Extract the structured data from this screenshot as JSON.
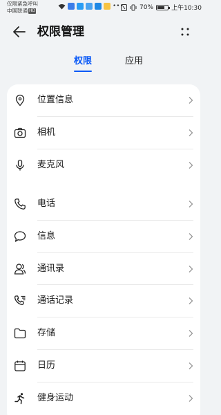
{
  "status_bar": {
    "line1": "仅限紧急呼叫",
    "line2": "中国联通",
    "hd": "HD",
    "battery_text": "70%",
    "battery_level": 0.7,
    "time": "上午10:30"
  },
  "header": {
    "title": "权限管理"
  },
  "tabs": [
    {
      "label": "权限",
      "active": true
    },
    {
      "label": "应用",
      "active": false
    }
  ],
  "permissions": [
    {
      "label": "位置信息",
      "icon": "location-pin-icon"
    },
    {
      "label": "相机",
      "icon": "camera-icon"
    },
    {
      "label": "麦克风",
      "icon": "microphone-icon"
    },
    {
      "label": "电话",
      "icon": "phone-icon"
    },
    {
      "label": "信息",
      "icon": "message-bubble-icon"
    },
    {
      "label": "通讯录",
      "icon": "contacts-icon"
    },
    {
      "label": "通话记录",
      "icon": "call-log-icon"
    },
    {
      "label": "存储",
      "icon": "folder-icon"
    },
    {
      "label": "日历",
      "icon": "calendar-icon"
    },
    {
      "label": "健身运动",
      "icon": "running-person-icon"
    }
  ],
  "colors": {
    "accent": "#0a59f7",
    "background": "#f1f3f5",
    "card": "#ffffff"
  }
}
